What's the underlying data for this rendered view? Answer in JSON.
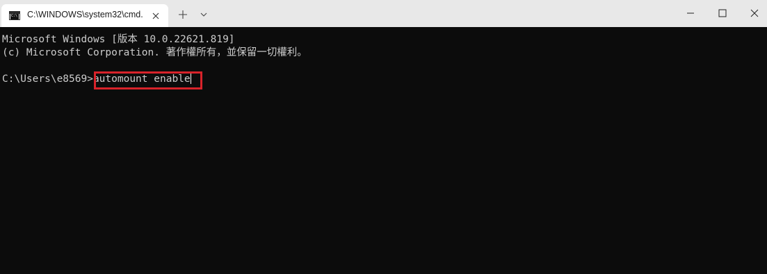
{
  "tab": {
    "title": "C:\\WINDOWS\\system32\\cmd.",
    "icon": "cmd-icon",
    "icon_text": "C:\\"
  },
  "titlebar": {
    "new_tab_icon": "plus-icon",
    "dropdown_icon": "chevron-down-icon",
    "minimize_icon": "minimize-icon",
    "maximize_icon": "maximize-icon",
    "close_icon": "close-icon"
  },
  "console": {
    "line1": "Microsoft Windows [版本 10.0.22621.819]",
    "line2": "(c) Microsoft Corporation. 著作權所有，並保留一切權利。",
    "prompt": "C:\\Users\\e8569>",
    "command": "automount enable"
  },
  "colors": {
    "background": "#0c0c0c",
    "text": "#cccccc",
    "titlebar": "#e8e8e8",
    "highlight": "#d8232a"
  }
}
